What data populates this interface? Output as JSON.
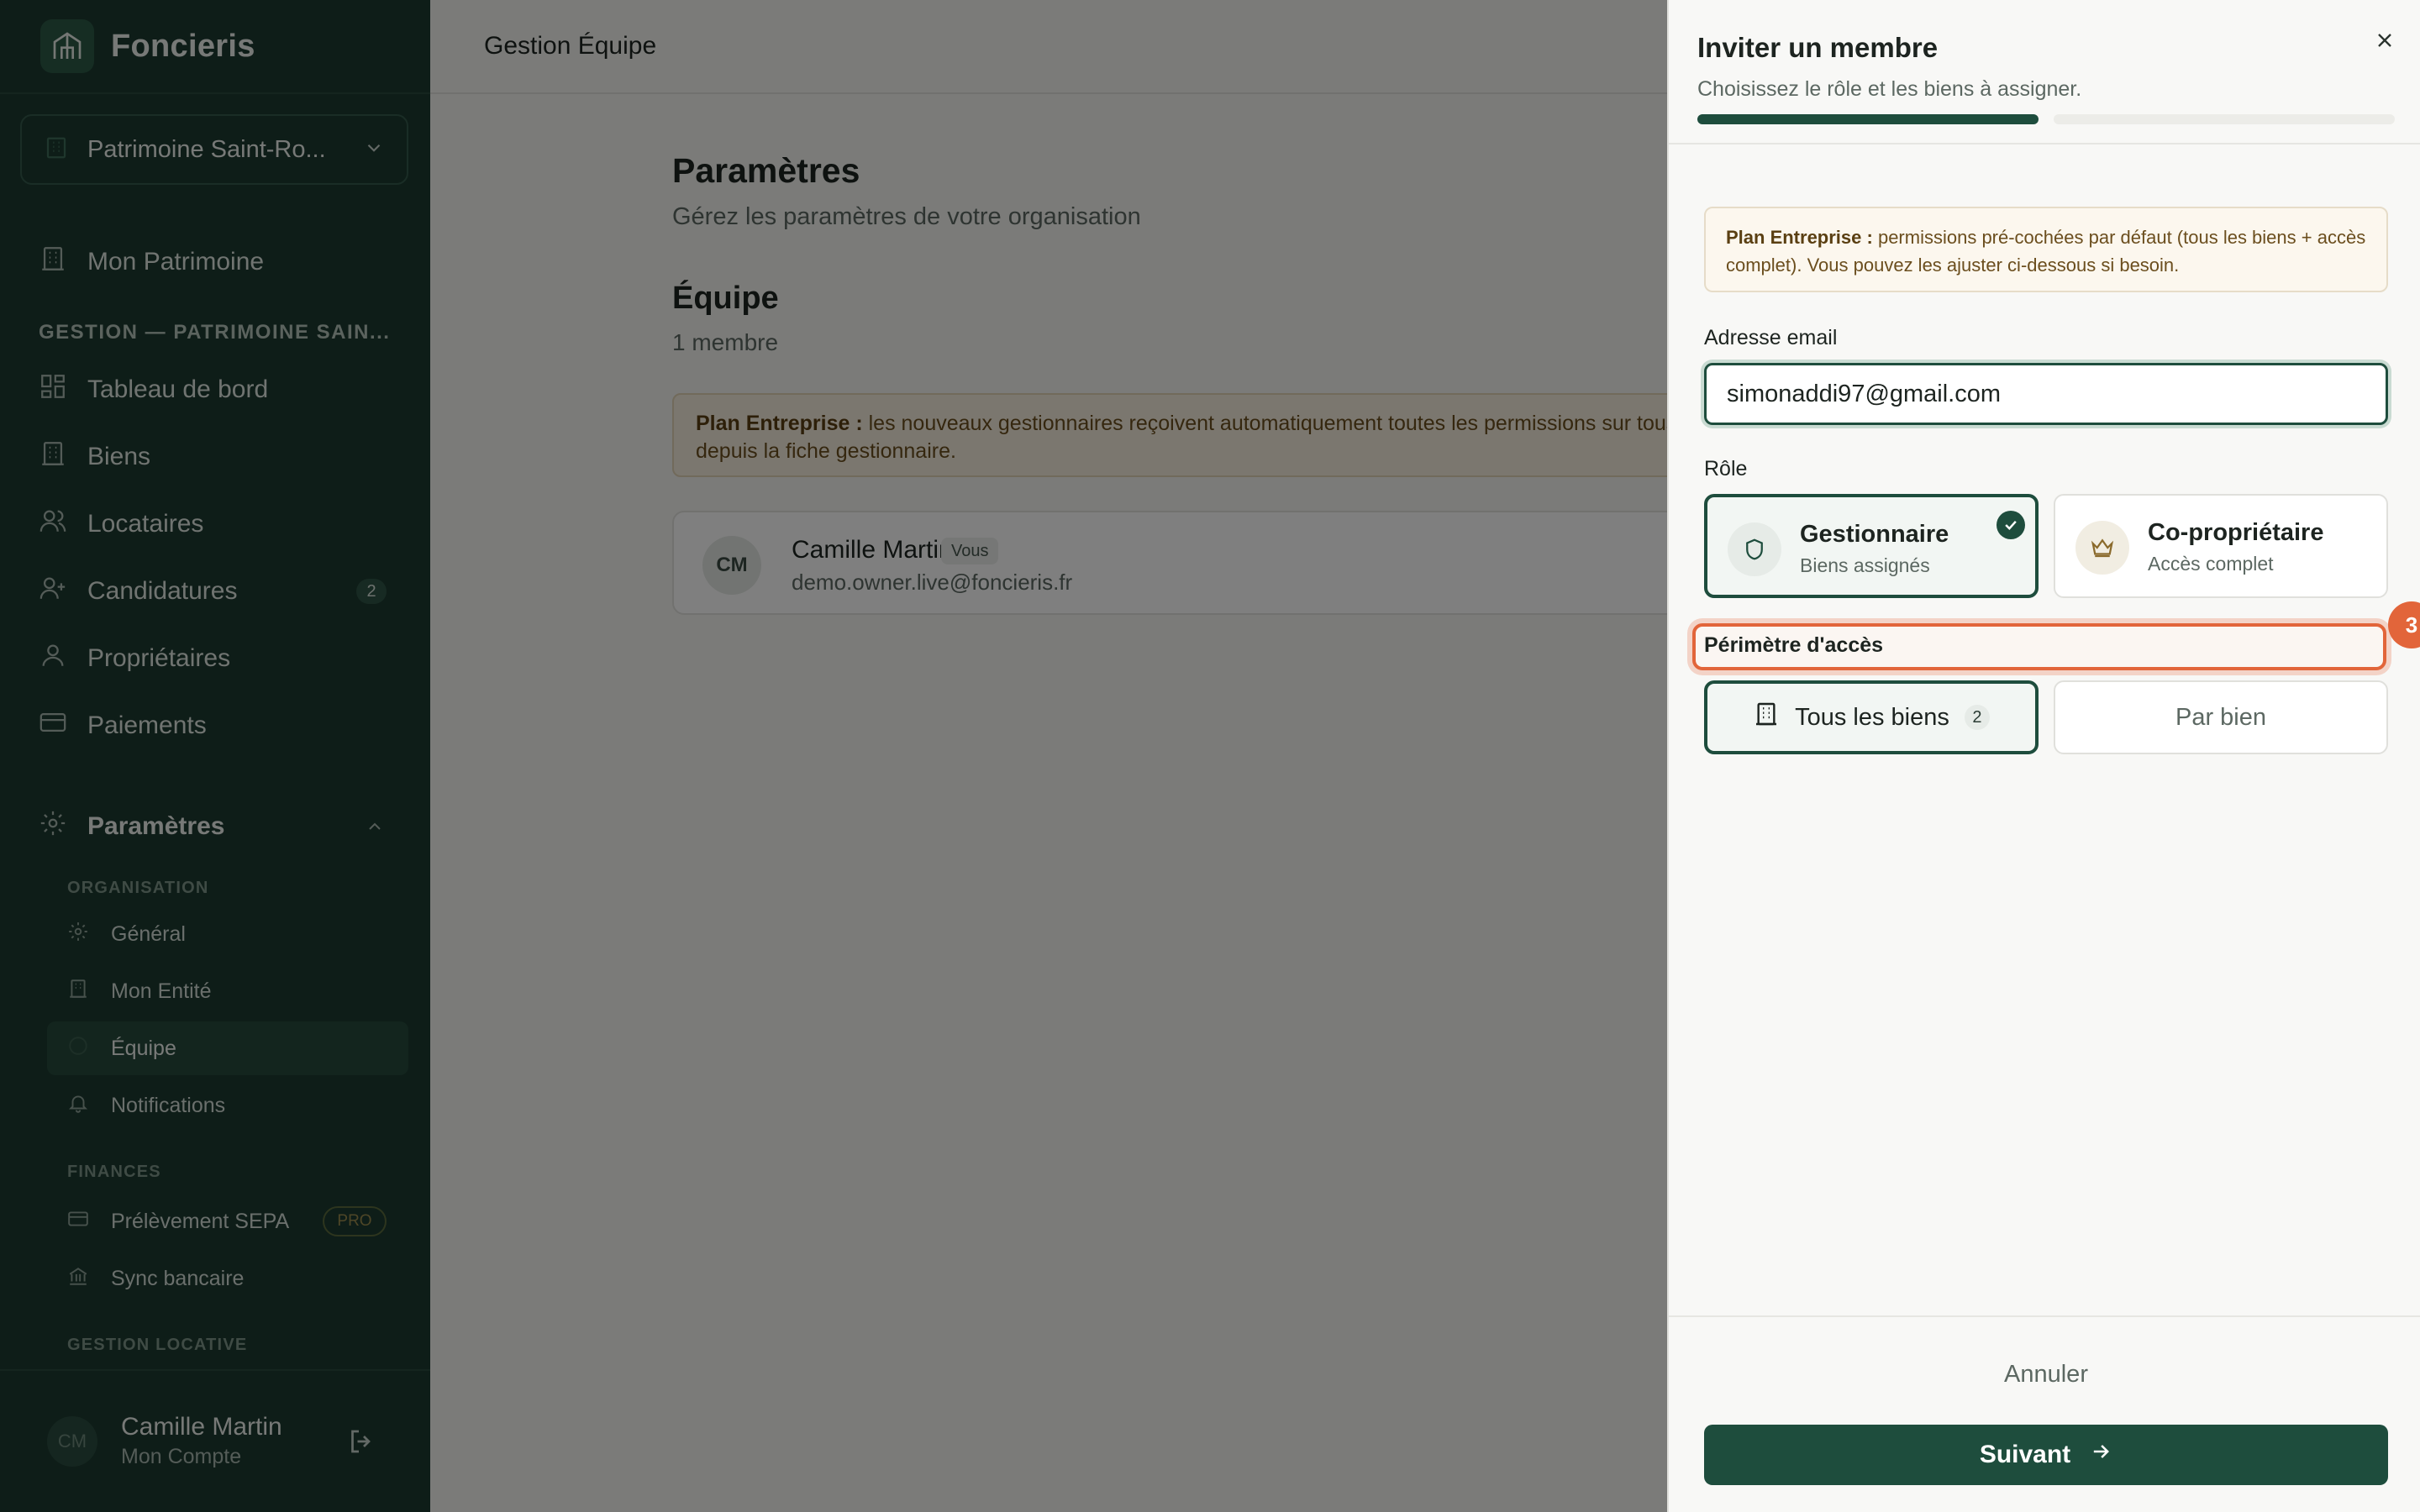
{
  "brand": {
    "name": "Foncieris"
  },
  "entity_selector": {
    "label": "Patrimoine Saint-Ro..."
  },
  "sidebar": {
    "top_item": "Mon Patrimoine",
    "section_title": "GESTION — PATRIMOINE SAIN...",
    "items": [
      {
        "label": "Tableau de bord"
      },
      {
        "label": "Biens"
      },
      {
        "label": "Locataires"
      },
      {
        "label": "Candidatures",
        "badge": "2"
      },
      {
        "label": "Propriétaires"
      },
      {
        "label": "Paiements"
      }
    ],
    "settings": {
      "label": "Paramètres",
      "group_organisation": "ORGANISATION",
      "organisation_items": [
        {
          "label": "Général"
        },
        {
          "label": "Mon Entité"
        },
        {
          "label": "Équipe"
        },
        {
          "label": "Notifications"
        }
      ],
      "group_finances": "FINANCES",
      "finance_items": [
        {
          "label": "Prélèvement SEPA",
          "badge": "PRO"
        },
        {
          "label": "Sync bancaire"
        }
      ],
      "group_gestion_locative": "GESTION LOCATIVE"
    },
    "user": {
      "initials": "CM",
      "name": "Camille Martin",
      "subtitle": "Mon Compte"
    }
  },
  "main": {
    "header_title": "Gestion Équipe",
    "page_title": "Paramètres",
    "page_subtitle": "Gérez les paramètres de votre organisation",
    "team_title": "Équipe",
    "team_count": "1 membre",
    "notice_bold": "Plan Entreprise :",
    "notice_text": " les nouveaux gestionnaires reçoivent automatiquement toutes les permissions sur tous les biens. Vous pouvez les ajuster après depuis la fiche gestionnaire.",
    "member": {
      "initials": "CM",
      "name": "Camille Martin",
      "badge": "Vous",
      "email": "demo.owner.live@foncieris.fr"
    }
  },
  "drawer": {
    "title": "Inviter un membre",
    "subtitle": "Choisissez le rôle et les biens à assigner.",
    "progress_steps_done": 1,
    "progress_steps_total": 2,
    "notice_bold": "Plan Entreprise :",
    "notice_text": " permissions pré-cochées par défaut (tous les biens + accès complet). Vous pouvez les ajuster ci-dessous si besoin.",
    "email_label": "Adresse email",
    "email_value": "simonaddi97@gmail.com",
    "role_label": "Rôle",
    "roles": [
      {
        "name": "Gestionnaire",
        "desc": "Biens assignés",
        "selected": true
      },
      {
        "name": "Co-propriétaire",
        "desc": "Accès complet",
        "selected": false
      }
    ],
    "perimeter_label": "Périmètre d'accès",
    "step_badge": "3",
    "scope_options": [
      {
        "label": "Tous les biens",
        "count": "2",
        "selected": true
      },
      {
        "label": "Par bien",
        "selected": false
      }
    ],
    "cancel_label": "Annuler",
    "next_label": "Suivant"
  },
  "colors": {
    "sidebar_bg": "#1d3a30",
    "accent": "#1e4d3d",
    "highlight": "#e2653a",
    "notice_bg": "#fcf7ee"
  }
}
